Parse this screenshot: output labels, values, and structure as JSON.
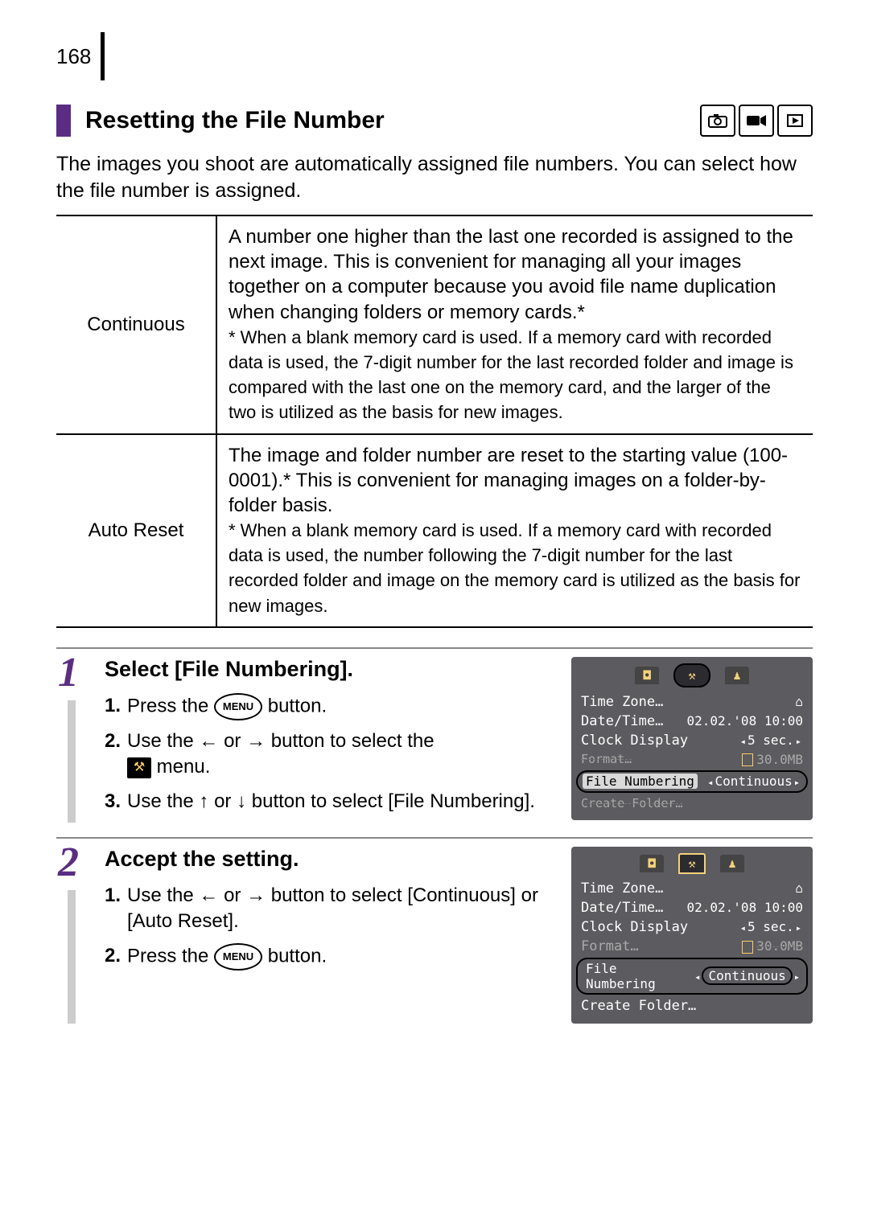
{
  "page_number": "168",
  "heading": "Resetting the File Number",
  "intro": "The images you shoot are automatically assigned file numbers. You can select how the file number is assigned.",
  "table": {
    "rows": [
      {
        "label": "Continuous",
        "body": "A number one higher than the last one recorded is assigned to the next image. This is convenient for managing all your images together on a computer because you avoid file name duplication when changing folders or memory cards.*",
        "note": "* When a blank memory card is used. If a memory card with recorded data is used, the 7-digit number for the last recorded folder and image is compared with the last one on the memory card, and the larger of the two is utilized as the basis for new images."
      },
      {
        "label": "Auto Reset",
        "body": "The image and folder number are reset to the starting value (100-0001).* This is convenient for managing images on a folder-by-folder basis.",
        "note": "* When a blank memory card is used. If a memory card with recorded data is used, the number following the 7-digit number for the last recorded folder and image on the memory card is utilized as the basis for new images."
      }
    ]
  },
  "steps": [
    {
      "num": "1",
      "title": "Select [File Numbering].",
      "subs": [
        {
          "n": "1.",
          "pre": "Press the ",
          "mid_type": "menu",
          "mid": "MENU",
          "post": " button."
        },
        {
          "n": "2.",
          "pre": "Use the ",
          "mid_type": "arrows_lr_tools",
          "post": " menu.",
          "arrows_text": " or ",
          "post_arrows": " button to select the "
        },
        {
          "n": "3.",
          "pre": "Use the ",
          "mid_type": "arrows_ud",
          "arrows_text": " or ",
          "post_arrows": " button to select [File Numbering]."
        }
      ]
    },
    {
      "num": "2",
      "title": "Accept the setting.",
      "subs": [
        {
          "n": "1.",
          "pre": "Use the ",
          "mid_type": "arrows_lr",
          "arrows_text": " or ",
          "post_arrows": " button to select [Continuous] or [Auto Reset]."
        },
        {
          "n": "2.",
          "pre": "Press the ",
          "mid_type": "menu",
          "mid": "MENU",
          "post": " button."
        }
      ]
    }
  ],
  "lcd": {
    "tabs": {
      "cam": "▣",
      "tools": "⚒",
      "person": "♟"
    },
    "rows": {
      "tz_k": "Time Zone…",
      "tz_v": "⌂",
      "dt_k": "Date/Time…",
      "dt_v": "02.02.'08 10:00",
      "cd_k": "Clock Display",
      "cd_v": "5 sec.",
      "fm_k": "Format…",
      "fm_v": "30.0MB",
      "fn_k": "File Numbering",
      "fn_v": "Continuous",
      "cf_k": "Create Folder…"
    }
  }
}
